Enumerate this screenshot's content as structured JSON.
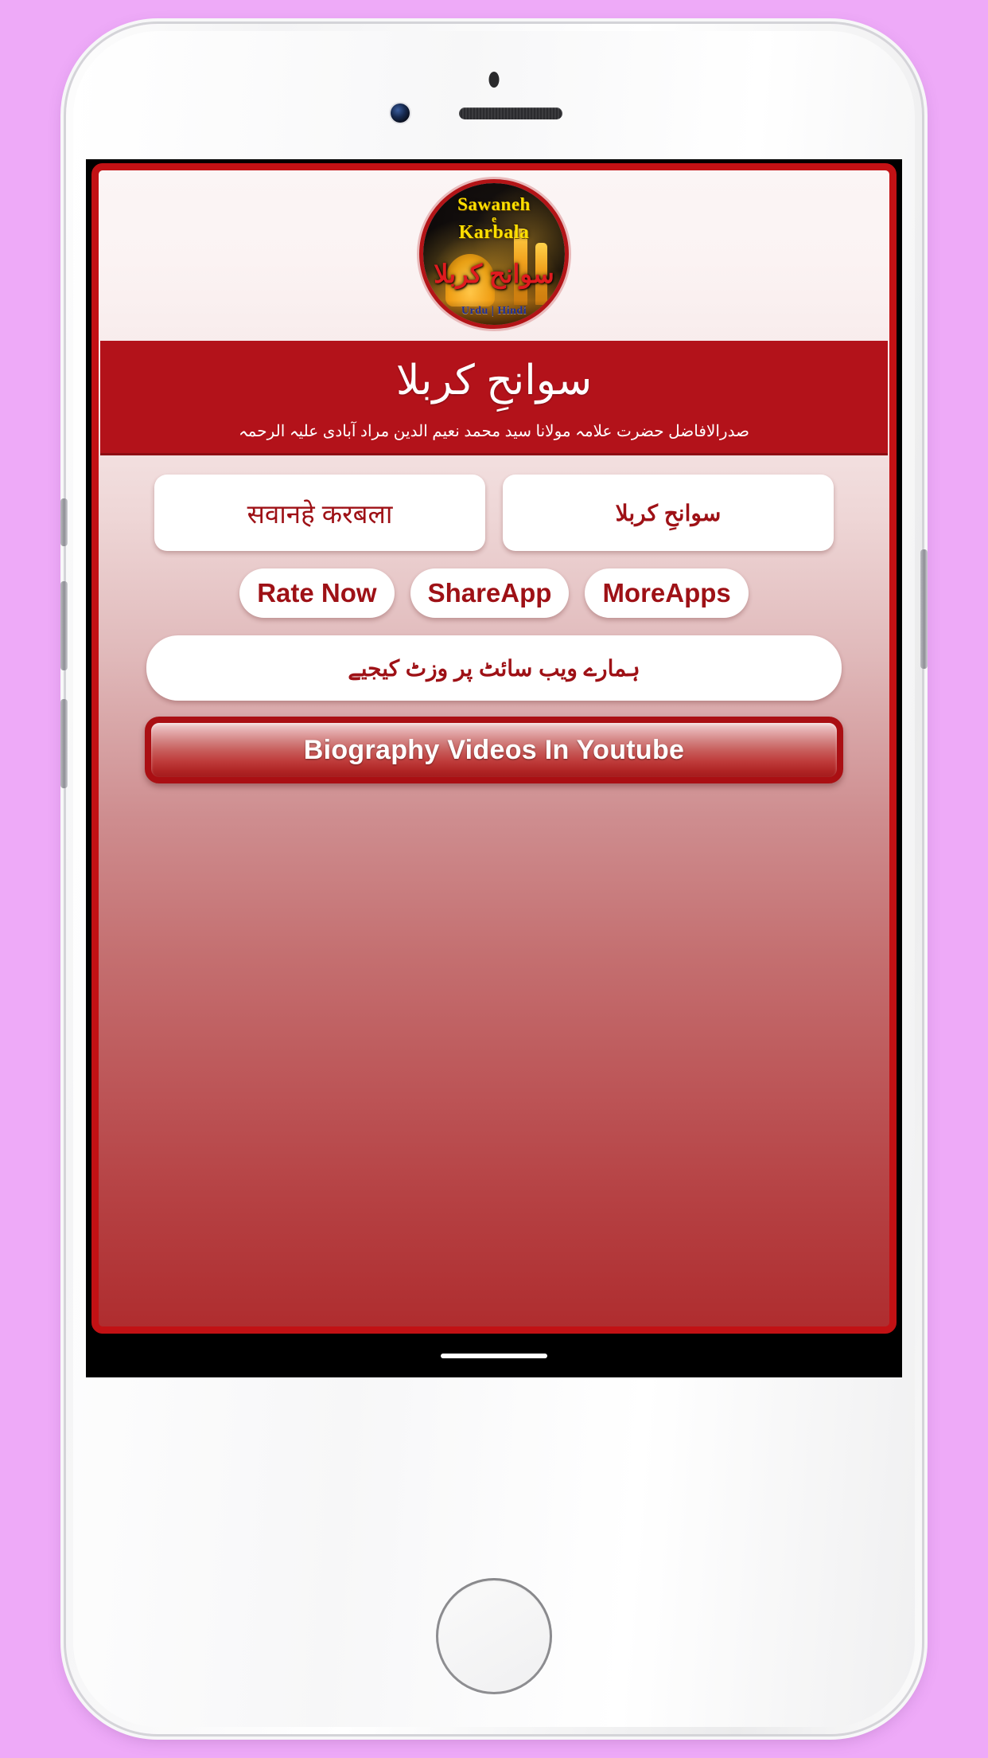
{
  "device": {
    "name": "white-iphone-mockup",
    "sensors": {
      "proximity": "sensor-dot",
      "camera": "front-camera",
      "earpiece": "earpiece-grille"
    },
    "home_button": "home-button"
  },
  "app": {
    "logo": {
      "english_line1": "Sawaneh",
      "english_line2": "e",
      "english_line3": "Karbala",
      "urdu_title": "سوانح کربلا",
      "languages_tag": "Urdu | Hindi"
    },
    "banner": {
      "title_urdu": "سوانحِ کربلا",
      "author_urdu": "صدرالافاضل حضرت علامہ مولانا سید محمد نعیم الدین مراد آبادی علیہ الرحمہ"
    },
    "language_buttons": [
      {
        "label": "सवानहे करबला",
        "script": "hindi"
      },
      {
        "label": "سوانحِ کربلا",
        "script": "urdu"
      }
    ],
    "action_buttons": [
      {
        "label": "Rate Now"
      },
      {
        "label": "ShareApp"
      },
      {
        "label": "MoreApps"
      }
    ],
    "website_button": {
      "label": "ہمارے ویب سائٹ پر وزٹ کیجیے"
    },
    "youtube_button": {
      "label": "Biography Videos In Youtube"
    }
  },
  "colors": {
    "page_background": "#eeaaf8",
    "app_border": "#c21114",
    "banner_red": "#b3121a",
    "text_red": "#9e1116",
    "logo_yellow": "#ffe000",
    "logo_urdu_red": "#e01b1f",
    "logo_tag_blue": "#1d2f9b",
    "navbar": "#000000"
  }
}
